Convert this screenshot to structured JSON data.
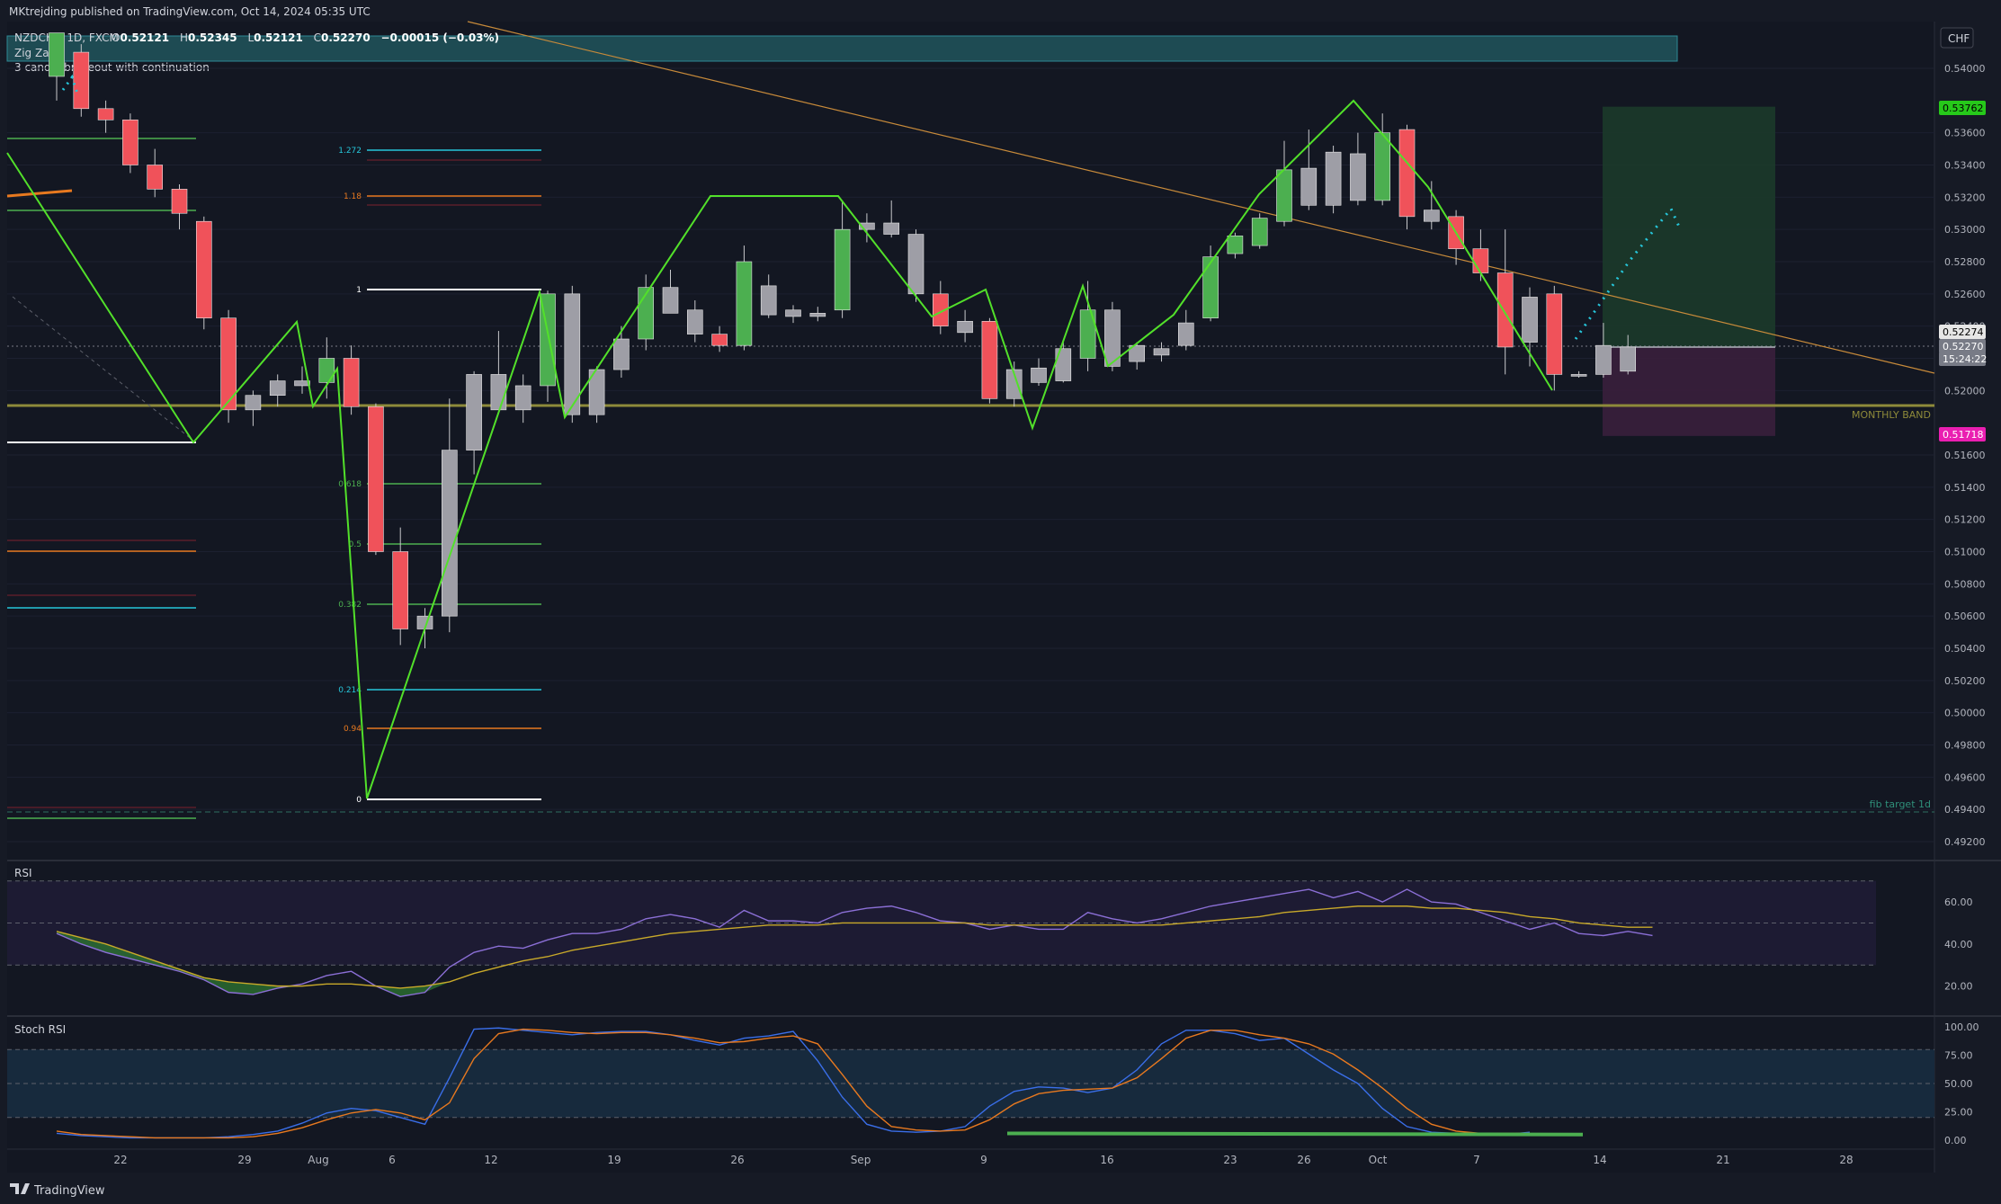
{
  "header": {
    "published": "MKtrejding published on TradingView.com, Oct 14, 2024 05:35 UTC",
    "symbol": "NZDCHF, 1D, FXCM",
    "ohlc": {
      "o_label": "O",
      "o": "0.52121",
      "h_label": "H",
      "h": "0.52345",
      "l_label": "L",
      "l": "0.52121",
      "c_label": "C",
      "c": "0.52270",
      "change": "−0.00015 (−0.03%)"
    },
    "indicators": [
      "Zig Zag",
      "3 candle brakeout with continuation"
    ]
  },
  "price_axis": {
    "currency": "CHF",
    "ticks": [
      "0.54000",
      "0.53600",
      "0.53400",
      "0.53200",
      "0.53000",
      "0.52800",
      "0.52600",
      "0.52400",
      "0.52200",
      "0.52000",
      "0.51600",
      "0.51400",
      "0.51200",
      "0.51000",
      "0.50800",
      "0.50600",
      "0.50400",
      "0.50200",
      "0.50000",
      "0.49800",
      "0.49600",
      "0.49400",
      "0.49200"
    ],
    "badges": [
      {
        "text": "0.53762",
        "bg": "#26c91a",
        "fg": "#000000"
      },
      {
        "text": "0.52274",
        "bg": "#e6e6e6",
        "fg": "#000000"
      },
      {
        "text": "0.52270",
        "bg": "#787b86",
        "fg": "#ffffff"
      },
      {
        "text": "15:24:22",
        "bg": "#787b86",
        "fg": "#ffffff"
      },
      {
        "text": "0.51718",
        "bg": "#ea1fb1",
        "fg": "#ffffff"
      }
    ]
  },
  "time_axis": {
    "labels": [
      "22",
      "29",
      "Aug",
      "6",
      "12",
      "19",
      "26",
      "Sep",
      "9",
      "16",
      "23",
      "26",
      "Oct",
      "7",
      "14",
      "21",
      "28"
    ]
  },
  "annotations": {
    "monthly_band": "MONTHLY BAND",
    "fib_target": "fib target 1d"
  },
  "fib_labels": [
    "1.272",
    "1.18",
    "1",
    "0.618",
    "0.5",
    "0.382",
    "0.214",
    "0.94",
    "0"
  ],
  "chart_data": [
    {
      "type": "candlestick",
      "title": "NZDCHF, 1D, FXCM",
      "ylim": [
        0.491,
        0.542
      ],
      "candles": [
        {
          "o": 0.5395,
          "h": 0.5418,
          "l": 0.538,
          "c": 0.5422,
          "color": "up"
        },
        {
          "o": 0.541,
          "h": 0.5415,
          "l": 0.537,
          "c": 0.5375,
          "color": "down"
        },
        {
          "o": 0.5375,
          "h": 0.538,
          "l": 0.536,
          "c": 0.5368,
          "color": "down"
        },
        {
          "o": 0.5368,
          "h": 0.5372,
          "l": 0.5335,
          "c": 0.534,
          "color": "down"
        },
        {
          "o": 0.534,
          "h": 0.535,
          "l": 0.532,
          "c": 0.5325,
          "color": "down"
        },
        {
          "o": 0.5325,
          "h": 0.5328,
          "l": 0.53,
          "c": 0.531,
          "color": "down"
        },
        {
          "o": 0.5305,
          "h": 0.5308,
          "l": 0.5238,
          "c": 0.5245,
          "color": "down"
        },
        {
          "o": 0.5245,
          "h": 0.525,
          "l": 0.518,
          "c": 0.5188,
          "color": "down"
        },
        {
          "o": 0.5188,
          "h": 0.52,
          "l": 0.5178,
          "c": 0.5197,
          "color": "neutral"
        },
        {
          "o": 0.5197,
          "h": 0.521,
          "l": 0.519,
          "c": 0.5206,
          "color": "neutral"
        },
        {
          "o": 0.5203,
          "h": 0.5215,
          "l": 0.5198,
          "c": 0.5206,
          "color": "neutral"
        },
        {
          "o": 0.5205,
          "h": 0.5233,
          "l": 0.5195,
          "c": 0.522,
          "color": "up"
        },
        {
          "o": 0.522,
          "h": 0.5228,
          "l": 0.5185,
          "c": 0.519,
          "color": "down"
        },
        {
          "o": 0.519,
          "h": 0.5192,
          "l": 0.5098,
          "c": 0.51,
          "color": "down"
        },
        {
          "o": 0.51,
          "h": 0.5115,
          "l": 0.5042,
          "c": 0.5052,
          "color": "down"
        },
        {
          "o": 0.5052,
          "h": 0.5065,
          "l": 0.504,
          "c": 0.506,
          "color": "neutral"
        },
        {
          "o": 0.506,
          "h": 0.5195,
          "l": 0.505,
          "c": 0.5163,
          "color": "neutral"
        },
        {
          "o": 0.5163,
          "h": 0.5212,
          "l": 0.5148,
          "c": 0.521,
          "color": "neutral"
        },
        {
          "o": 0.521,
          "h": 0.5237,
          "l": 0.5188,
          "c": 0.5188,
          "color": "neutral"
        },
        {
          "o": 0.5188,
          "h": 0.521,
          "l": 0.518,
          "c": 0.5203,
          "color": "neutral"
        },
        {
          "o": 0.5203,
          "h": 0.5262,
          "l": 0.5193,
          "c": 0.526,
          "color": "up"
        },
        {
          "o": 0.526,
          "h": 0.5265,
          "l": 0.518,
          "c": 0.5185,
          "color": "neutral"
        },
        {
          "o": 0.5185,
          "h": 0.5215,
          "l": 0.518,
          "c": 0.5213,
          "color": "neutral"
        },
        {
          "o": 0.5213,
          "h": 0.524,
          "l": 0.5208,
          "c": 0.5232,
          "color": "neutral"
        },
        {
          "o": 0.5232,
          "h": 0.5272,
          "l": 0.5225,
          "c": 0.5264,
          "color": "up"
        },
        {
          "o": 0.5264,
          "h": 0.5275,
          "l": 0.5248,
          "c": 0.5248,
          "color": "neutral"
        },
        {
          "o": 0.525,
          "h": 0.5256,
          "l": 0.523,
          "c": 0.5235,
          "color": "neutral"
        },
        {
          "o": 0.5235,
          "h": 0.524,
          "l": 0.5224,
          "c": 0.5228,
          "color": "down"
        },
        {
          "o": 0.5228,
          "h": 0.529,
          "l": 0.5225,
          "c": 0.528,
          "color": "up"
        },
        {
          "o": 0.5265,
          "h": 0.5272,
          "l": 0.5245,
          "c": 0.5247,
          "color": "neutral"
        },
        {
          "o": 0.5246,
          "h": 0.5253,
          "l": 0.5242,
          "c": 0.525,
          "color": "neutral"
        },
        {
          "o": 0.5246,
          "h": 0.5252,
          "l": 0.5243,
          "c": 0.5248,
          "color": "neutral"
        },
        {
          "o": 0.525,
          "h": 0.5318,
          "l": 0.5245,
          "c": 0.53,
          "color": "up"
        },
        {
          "o": 0.53,
          "h": 0.531,
          "l": 0.5292,
          "c": 0.5304,
          "color": "neutral"
        },
        {
          "o": 0.5304,
          "h": 0.5318,
          "l": 0.5295,
          "c": 0.5297,
          "color": "neutral"
        },
        {
          "o": 0.5297,
          "h": 0.53,
          "l": 0.5255,
          "c": 0.526,
          "color": "neutral"
        },
        {
          "o": 0.526,
          "h": 0.5268,
          "l": 0.5235,
          "c": 0.524,
          "color": "down"
        },
        {
          "o": 0.5243,
          "h": 0.525,
          "l": 0.523,
          "c": 0.5236,
          "color": "neutral"
        },
        {
          "o": 0.5243,
          "h": 0.5245,
          "l": 0.5192,
          "c": 0.5195,
          "color": "down"
        },
        {
          "o": 0.5195,
          "h": 0.5218,
          "l": 0.519,
          "c": 0.5213,
          "color": "neutral"
        },
        {
          "o": 0.5205,
          "h": 0.522,
          "l": 0.5203,
          "c": 0.5214,
          "color": "neutral"
        },
        {
          "o": 0.5206,
          "h": 0.523,
          "l": 0.5205,
          "c": 0.5226,
          "color": "neutral"
        },
        {
          "o": 0.522,
          "h": 0.5268,
          "l": 0.5212,
          "c": 0.525,
          "color": "up"
        },
        {
          "o": 0.525,
          "h": 0.5255,
          "l": 0.5212,
          "c": 0.5215,
          "color": "neutral"
        },
        {
          "o": 0.5218,
          "h": 0.523,
          "l": 0.5213,
          "c": 0.5228,
          "color": "neutral"
        },
        {
          "o": 0.5222,
          "h": 0.523,
          "l": 0.5218,
          "c": 0.5226,
          "color": "neutral"
        },
        {
          "o": 0.5228,
          "h": 0.525,
          "l": 0.5225,
          "c": 0.5242,
          "color": "neutral"
        },
        {
          "o": 0.5245,
          "h": 0.529,
          "l": 0.5243,
          "c": 0.5283,
          "color": "up"
        },
        {
          "o": 0.5285,
          "h": 0.5298,
          "l": 0.5282,
          "c": 0.5296,
          "color": "up"
        },
        {
          "o": 0.529,
          "h": 0.531,
          "l": 0.5288,
          "c": 0.5307,
          "color": "up"
        },
        {
          "o": 0.5305,
          "h": 0.5355,
          "l": 0.5302,
          "c": 0.5337,
          "color": "up"
        },
        {
          "o": 0.5338,
          "h": 0.5362,
          "l": 0.5312,
          "c": 0.5315,
          "color": "neutral"
        },
        {
          "o": 0.5315,
          "h": 0.5352,
          "l": 0.531,
          "c": 0.5348,
          "color": "neutral"
        },
        {
          "o": 0.5347,
          "h": 0.536,
          "l": 0.5315,
          "c": 0.5318,
          "color": "neutral"
        },
        {
          "o": 0.5318,
          "h": 0.5372,
          "l": 0.5315,
          "c": 0.536,
          "color": "up"
        },
        {
          "o": 0.5362,
          "h": 0.5365,
          "l": 0.53,
          "c": 0.5308,
          "color": "down"
        },
        {
          "o": 0.5312,
          "h": 0.533,
          "l": 0.53,
          "c": 0.5305,
          "color": "neutral"
        },
        {
          "o": 0.5308,
          "h": 0.5312,
          "l": 0.5278,
          "c": 0.5288,
          "color": "down"
        },
        {
          "o": 0.5288,
          "h": 0.53,
          "l": 0.5268,
          "c": 0.5273,
          "color": "down"
        },
        {
          "o": 0.5273,
          "h": 0.53,
          "l": 0.521,
          "c": 0.5227,
          "color": "down"
        },
        {
          "o": 0.523,
          "h": 0.5264,
          "l": 0.5215,
          "c": 0.5258,
          "color": "neutral"
        },
        {
          "o": 0.526,
          "h": 0.5265,
          "l": 0.52,
          "c": 0.521,
          "color": "down"
        },
        {
          "o": 0.521,
          "h": 0.5212,
          "l": 0.5208,
          "c": 0.521,
          "color": "neutral"
        },
        {
          "o": 0.521,
          "h": 0.5242,
          "l": 0.5208,
          "c": 0.5228,
          "color": "neutral"
        },
        {
          "o": 0.5212,
          "h": 0.52345,
          "l": 0.521,
          "c": 0.5227,
          "color": "neutral"
        }
      ]
    },
    {
      "type": "line",
      "title": "RSI",
      "ylim": [
        10,
        75
      ],
      "ticks": [
        "60.00",
        "40.00",
        "20.00"
      ],
      "bands": [
        30,
        50,
        70
      ],
      "series": [
        {
          "values": [
            45,
            40,
            36,
            33,
            30,
            27,
            23,
            17,
            16,
            19,
            21,
            25,
            27,
            20,
            15,
            17,
            29,
            36,
            39,
            38,
            42,
            45,
            45,
            47,
            52,
            54,
            52,
            48,
            56,
            51,
            51,
            50,
            55,
            57,
            58,
            55,
            51,
            50,
            47,
            49,
            47,
            47,
            55,
            52,
            50,
            52,
            55,
            58,
            60,
            62,
            64,
            66,
            62,
            65,
            60,
            66,
            60,
            59,
            55,
            51,
            47,
            50,
            45,
            44,
            46,
            44
          ],
          "color": "#8b6fd6"
        },
        {
          "values": [
            46,
            43,
            40,
            36,
            32,
            28,
            24,
            22,
            21,
            20,
            20,
            21,
            21,
            20,
            19,
            20,
            22,
            26,
            29,
            32,
            34,
            37,
            39,
            41,
            43,
            45,
            46,
            47,
            48,
            49,
            49,
            49,
            50,
            50,
            50,
            50,
            50,
            50,
            49,
            49,
            49,
            49,
            49,
            49,
            49,
            49,
            50,
            51,
            52,
            53,
            55,
            56,
            57,
            58,
            58,
            58,
            57,
            57,
            56,
            55,
            53,
            52,
            50,
            49,
            48,
            48
          ],
          "color": "#c8a92a"
        }
      ]
    },
    {
      "type": "line",
      "title": "Stoch RSI",
      "ylim": [
        0,
        100
      ],
      "ticks": [
        "100.00",
        "75.00",
        "50.00",
        "25.00",
        "0.00"
      ],
      "bands": [
        20,
        50,
        80
      ],
      "series": [
        {
          "values": [
            6,
            4,
            3,
            2,
            2,
            2,
            2,
            3,
            5,
            8,
            15,
            24,
            28,
            26,
            20,
            14,
            55,
            98,
            99,
            97,
            95,
            93,
            95,
            96,
            96,
            93,
            88,
            84,
            90,
            92,
            96,
            70,
            38,
            14,
            8,
            7,
            8,
            12,
            30,
            43,
            47,
            46,
            42,
            46,
            62,
            85,
            97,
            97,
            94,
            88,
            90,
            76,
            62,
            50,
            28,
            12,
            7,
            6,
            5,
            5,
            7
          ],
          "color": "#3a6ee8"
        },
        {
          "values": [
            8,
            5,
            4,
            3,
            2,
            2,
            2,
            2,
            3,
            6,
            11,
            18,
            24,
            27,
            24,
            18,
            33,
            72,
            94,
            98,
            97,
            95,
            94,
            95,
            95,
            93,
            90,
            86,
            87,
            90,
            92,
            85,
            58,
            30,
            12,
            9,
            8,
            9,
            18,
            32,
            41,
            44,
            45,
            46,
            55,
            72,
            90,
            97,
            97,
            93,
            90,
            85,
            76,
            62,
            46,
            28,
            14,
            8,
            6,
            6,
            6
          ],
          "color": "#e8791f"
        }
      ]
    }
  ]
}
